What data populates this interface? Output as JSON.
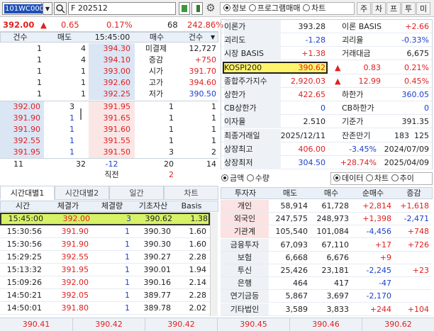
{
  "toolbar": {
    "code": "101WC000",
    "market": "F",
    "contract": "202512",
    "radio_info": "정보",
    "radio_program": "프로그램매매",
    "radio_chart": "차트",
    "btns": [
      "주",
      "차",
      "프",
      "투",
      "미"
    ]
  },
  "summary": {
    "price": "392.00",
    "arrow": "▲",
    "change": "0.65",
    "pct": "0.17%",
    "vol": "68",
    "ratio": "242.86%"
  },
  "ob": {
    "headers": [
      "건수",
      "매도",
      "15:45:00",
      "매수",
      "건수"
    ],
    "asks": [
      [
        "1",
        "4",
        "394.30",
        "미결제",
        "12,727"
      ],
      [
        "1",
        "4",
        "394.10",
        "증감",
        "+750"
      ],
      [
        "1",
        "1",
        "393.00",
        "시가",
        "391.70"
      ],
      [
        "1",
        "1",
        "392.60",
        "고가",
        "394.60"
      ],
      [
        "1",
        "1",
        "392.25",
        "저가",
        "390.50"
      ]
    ],
    "bids": [
      [
        "392.00",
        "3",
        "391.95",
        "1",
        "1"
      ],
      [
        "391.90",
        "1",
        "391.65",
        "1",
        "1"
      ],
      [
        "391.90",
        "1",
        "391.60",
        "1",
        "1"
      ],
      [
        "392.55",
        "1",
        "391.55",
        "1",
        "1"
      ],
      [
        "391.95",
        "1",
        "391.50",
        "3",
        "2"
      ]
    ],
    "total": [
      "11",
      "32",
      "-12",
      "20",
      "14"
    ],
    "prev_label": "직전",
    "prev_val": "2"
  },
  "tabs": [
    "시간대별1",
    "시간대별2",
    "일간",
    "차트"
  ],
  "ticks": {
    "headers": [
      "시간",
      "체결가",
      "체결량",
      "기초자산",
      "Basis"
    ],
    "rows": [
      [
        "15:45:00",
        "392.00",
        "3",
        "390.62",
        "1.38"
      ],
      [
        "15:30:56",
        "391.90",
        "1",
        "390.30",
        "1.60"
      ],
      [
        "15:30:56",
        "391.90",
        "1",
        "390.30",
        "1.60"
      ],
      [
        "15:29:25",
        "392.55",
        "1",
        "390.27",
        "2.28"
      ],
      [
        "15:13:32",
        "391.95",
        "1",
        "390.01",
        "1.94"
      ],
      [
        "15:09:26",
        "392.00",
        "1",
        "390.16",
        "2.14"
      ],
      [
        "14:50:21",
        "392.05",
        "1",
        "389.77",
        "2.28"
      ],
      [
        "14:50:01",
        "391.80",
        "1",
        "389.78",
        "2.02"
      ]
    ]
  },
  "info": {
    "rows": [
      [
        "이론가",
        "393.28",
        "이론 BASIS",
        "+2.66"
      ],
      [
        "괴리도",
        "-1.28",
        "괴리율",
        "-0.33%"
      ],
      [
        "시장 BASIS",
        "+1.38",
        "거래대금",
        "6,675"
      ],
      [
        "KOSPI200",
        "390.62",
        "0.83",
        "0.21%"
      ],
      [
        "종합주가지수",
        "2,920.03",
        "12.99",
        "0.45%"
      ],
      [
        "상한가",
        "422.65",
        "하한가",
        "360.05"
      ],
      [
        "CB상한가",
        "0",
        "CB하한가",
        "0"
      ],
      [
        "이자율",
        "2.510",
        "기준가",
        "391.35"
      ],
      [
        "최종거래일",
        "2025/12/11",
        "잔존만기",
        "183",
        "125"
      ],
      [
        "상장최고",
        "406.00",
        "-3.45%",
        "2024/07/09"
      ],
      [
        "상장최저",
        "304.50",
        "+28.74%",
        "2025/04/09"
      ]
    ]
  },
  "inv": {
    "radio1": "금액",
    "radio2": "수량",
    "radio3": "데이터",
    "radio4": "차트",
    "radio5": "추이",
    "headers": [
      "투자자",
      "매도",
      "매수",
      "순매수",
      "증감"
    ],
    "rows": [
      [
        "개인",
        "58,914",
        "61,728",
        "+2,814",
        "+1,618"
      ],
      [
        "외국인",
        "247,575",
        "248,973",
        "+1,398",
        "-2,471"
      ],
      [
        "기관계",
        "105,540",
        "101,084",
        "-4,456",
        "+748"
      ],
      [
        "금융투자",
        "67,093",
        "67,110",
        "+17",
        "+726"
      ],
      [
        "보험",
        "6,668",
        "6,676",
        "+9",
        ""
      ],
      [
        "투신",
        "25,426",
        "23,181",
        "-2,245",
        "+23"
      ],
      [
        "은행",
        "464",
        "417",
        "-47",
        ""
      ],
      [
        "연기금등",
        "5,867",
        "3,697",
        "-2,170",
        ""
      ],
      [
        "기타법인",
        "3,589",
        "3,833",
        "+244",
        "+104"
      ]
    ]
  },
  "bottom": [
    "390.41",
    "390.42",
    "390.42",
    "390.45",
    "390.46",
    "390.62"
  ]
}
